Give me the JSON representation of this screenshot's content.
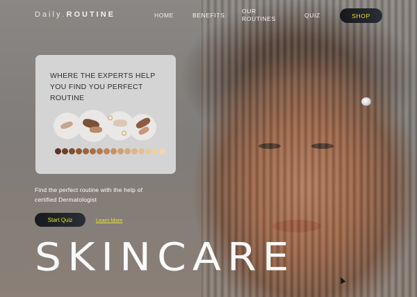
{
  "brand": {
    "light": "Daily",
    "dot": ".",
    "bold": "ROUTINE"
  },
  "nav": {
    "home": "HOME",
    "benefits": "BENEFITS",
    "routines": "OUR ROUTINES",
    "quiz": "QUIZ",
    "shop": "SHOP"
  },
  "card": {
    "title": "WHERE THE EXPERTS HELP YOU FIND YOU PERFECT ROUTINE",
    "swatch_colors": [
      "#5a3524",
      "#6e4129",
      "#7d4c31",
      "#8d5837",
      "#9a643f",
      "#a87048",
      "#b27a50",
      "#bd865b",
      "#c69264",
      "#cf9e70",
      "#d6a97b",
      "#ddb587",
      "#e3c094",
      "#e8c99e",
      "#ecd1a8",
      "#efd7b0"
    ]
  },
  "hero": {
    "description": "Find the perfect routine with the help of certified Dermatologist",
    "start_quiz": "Start Quiz",
    "learn_more": "Learn More",
    "big_title": "SKINCARE"
  },
  "colors": {
    "accent": "#e8e22a",
    "button_dark": "#18191e",
    "card_bg": "#d4d4d4"
  }
}
